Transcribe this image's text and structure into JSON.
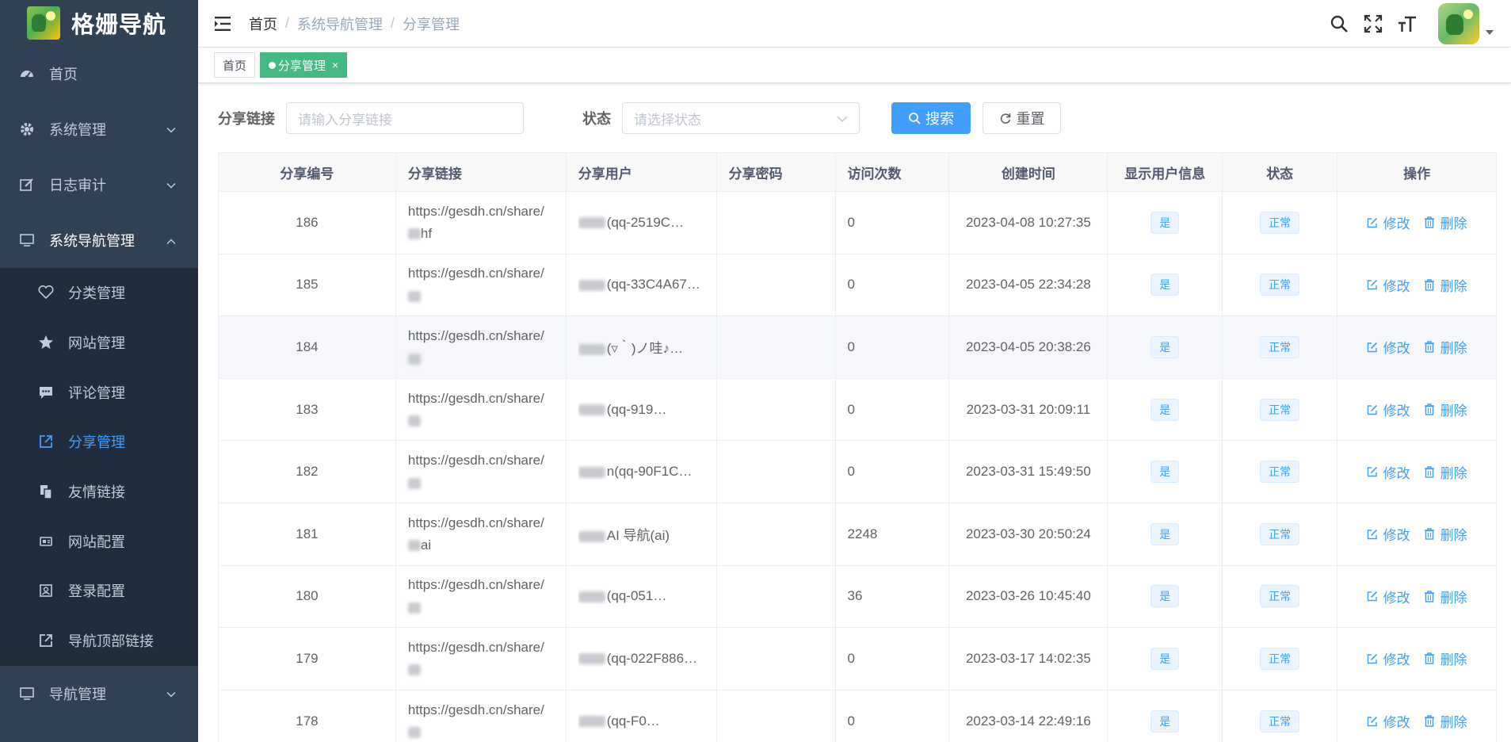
{
  "app": {
    "title": "格姗导航"
  },
  "sidebar": {
    "items": [
      {
        "label": "首页",
        "icon": "dashboard-icon"
      },
      {
        "label": "系统管理",
        "icon": "gear-icon",
        "expandable": true
      },
      {
        "label": "日志审计",
        "icon": "edit-icon",
        "expandable": true
      },
      {
        "label": "系统导航管理",
        "icon": "monitor-icon",
        "expanded": true
      }
    ],
    "subitems": [
      {
        "label": "分类管理",
        "icon": "heart-icon"
      },
      {
        "label": "网站管理",
        "icon": "star-icon"
      },
      {
        "label": "评论管理",
        "icon": "comment-icon"
      },
      {
        "label": "分享管理",
        "icon": "share-icon",
        "active": true
      },
      {
        "label": "友情链接",
        "icon": "documents-icon"
      },
      {
        "label": "网站配置",
        "icon": "config-icon"
      },
      {
        "label": "登录配置",
        "icon": "login-config-icon"
      },
      {
        "label": "导航顶部链接",
        "icon": "external-link-icon"
      }
    ],
    "bottom": {
      "label": "导航管理",
      "icon": "monitor-icon"
    }
  },
  "header": {
    "breadcrumb": [
      "首页",
      "系统导航管理",
      "分享管理"
    ],
    "separator": "/"
  },
  "tags": [
    {
      "label": "首页",
      "active": false
    },
    {
      "label": "分享管理",
      "active": true,
      "close": "×"
    }
  ],
  "search": {
    "link_label": "分享链接",
    "link_placeholder": "请输入分享链接",
    "status_label": "状态",
    "status_placeholder": "请选择状态",
    "search_button": "搜索",
    "reset_button": "重置"
  },
  "table": {
    "headers": [
      "分享编号",
      "分享链接",
      "分享用户",
      "分享密码",
      "访问次数",
      "创建时间",
      "显示用户信息",
      "状态",
      "操作"
    ],
    "edit_label": "修改",
    "delete_label": "删除",
    "rows": [
      {
        "id": "186",
        "link": "https://gesdh.cn/share/",
        "link_tail": "hf",
        "user": "(qq-2519C…",
        "password": "",
        "visits": "0",
        "created": "2023-04-08 10:27:35",
        "show_user": "是",
        "status": "正常"
      },
      {
        "id": "185",
        "link": "https://gesdh.cn/share/",
        "link_tail": "",
        "user": "(qq-33C4A67…",
        "password": "",
        "visits": "0",
        "created": "2023-04-05 22:34:28",
        "show_user": "是",
        "status": "正常"
      },
      {
        "id": "184",
        "link": "https://gesdh.cn/share/",
        "link_tail": "",
        "user": "(▿｀)ノ哇♪…",
        "password": "",
        "visits": "0",
        "created": "2023-04-05 20:38:26",
        "show_user": "是",
        "status": "正常"
      },
      {
        "id": "183",
        "link": "https://gesdh.cn/share/",
        "link_tail": "",
        "user": "(qq-919…",
        "password": "",
        "visits": "0",
        "created": "2023-03-31 20:09:11",
        "show_user": "是",
        "status": "正常"
      },
      {
        "id": "182",
        "link": "https://gesdh.cn/share/",
        "link_tail": "",
        "user": "n(qq-90F1C…",
        "password": "",
        "visits": "0",
        "created": "2023-03-31 15:49:50",
        "show_user": "是",
        "status": "正常"
      },
      {
        "id": "181",
        "link": "https://gesdh.cn/share/",
        "link_tail": "ai",
        "user": "AI 导航(ai)",
        "password": "",
        "visits": "2248",
        "created": "2023-03-30 20:50:24",
        "show_user": "是",
        "status": "正常"
      },
      {
        "id": "180",
        "link": "https://gesdh.cn/share/",
        "link_tail": "",
        "user": "(qq-051…",
        "password": "",
        "visits": "36",
        "created": "2023-03-26 10:45:40",
        "show_user": "是",
        "status": "正常"
      },
      {
        "id": "179",
        "link": "https://gesdh.cn/share/",
        "link_tail": "",
        "user": "(qq-022F886…",
        "password": "",
        "visits": "0",
        "created": "2023-03-17 14:02:35",
        "show_user": "是",
        "status": "正常"
      },
      {
        "id": "178",
        "link": "https://gesdh.cn/share/",
        "link_tail": "",
        "user": "(qq-F0…",
        "password": "",
        "visits": "0",
        "created": "2023-03-14 22:49:16",
        "show_user": "是",
        "status": "正常"
      }
    ]
  },
  "colors": {
    "sidebar_bg": "#304156",
    "submenu_bg": "#1f2d3d",
    "accent": "#409eff",
    "tag_active": "#42b983"
  }
}
